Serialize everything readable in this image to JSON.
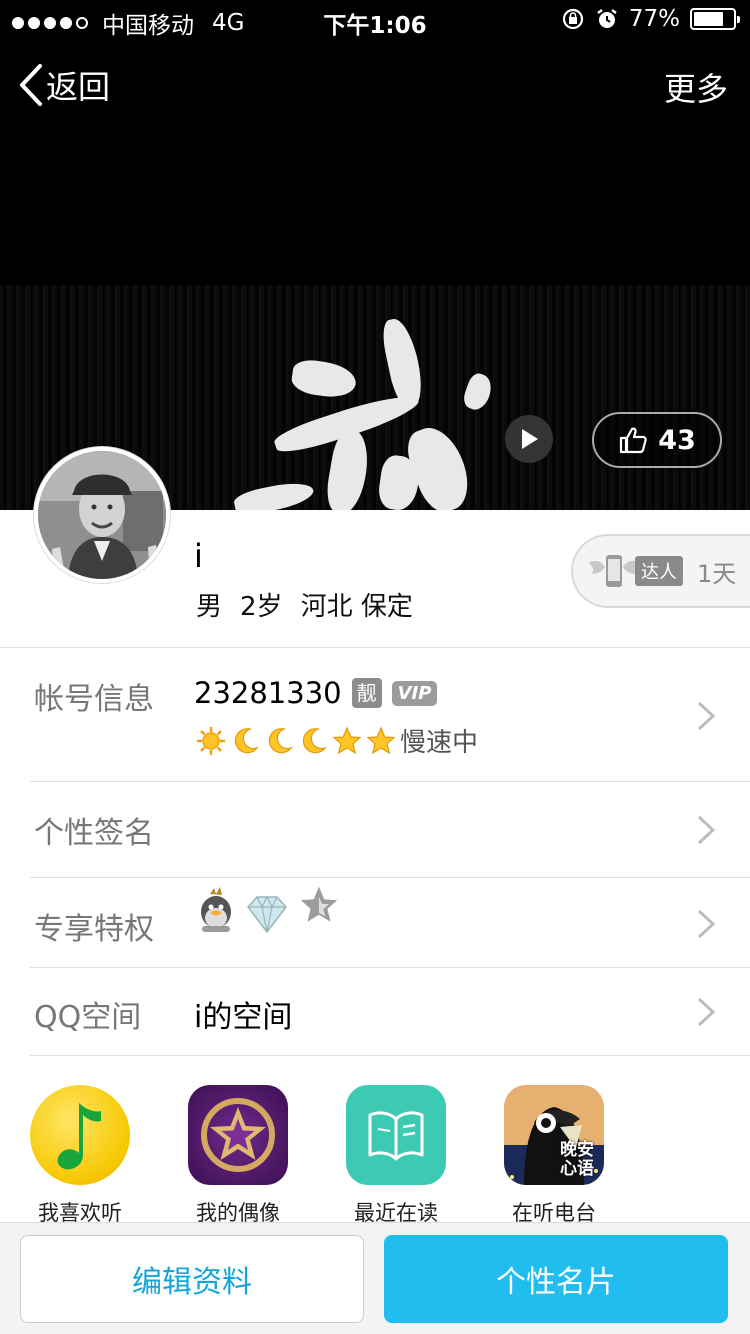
{
  "status_bar": {
    "carrier": "中国移动",
    "network": "4G",
    "time": "下午1:06",
    "battery_text": "77%",
    "battery_level": 0.77
  },
  "nav": {
    "back_label": "返回",
    "more_label": "更多"
  },
  "cover": {
    "like_count": "43"
  },
  "profile": {
    "nickname": "i",
    "gender": "男",
    "age": "2岁",
    "location": "河北 保定",
    "daren_tag": "达人",
    "daren_days": "1天"
  },
  "rows": {
    "account": {
      "label": "帐号信息",
      "number": "23281330",
      "liang_badge": "靓",
      "vip_badge": "VIP",
      "level_status": "慢速中"
    },
    "signature": {
      "label": "个性签名"
    },
    "privileges": {
      "label": "专享特权"
    },
    "qzone": {
      "label": "QQ空间",
      "value": "i的空间"
    }
  },
  "apps": [
    {
      "label": "我喜欢听",
      "icon": "qq-music-icon"
    },
    {
      "label": "我的偶像",
      "icon": "idol-star-icon"
    },
    {
      "label": "最近在读",
      "icon": "book-icon"
    },
    {
      "label": "在听电台",
      "icon": "radio-icon"
    }
  ],
  "app_extra_text": {
    "radio_icon_text": "晚安心语"
  },
  "bottom": {
    "edit_label": "编辑资料",
    "card_label": "个性名片"
  },
  "colors": {
    "accent": "#21bdef",
    "accent_text": "#14a5d8"
  }
}
